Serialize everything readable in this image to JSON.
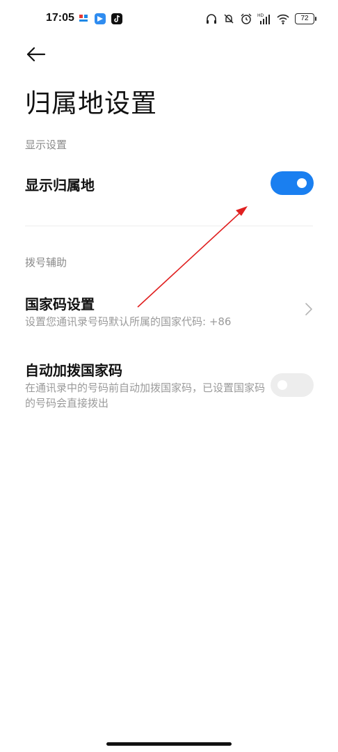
{
  "status_bar": {
    "time": "17:05",
    "battery": "72",
    "icons": [
      "headphones-icon",
      "mute-icon",
      "alarm-icon",
      "hd-signal-icon",
      "wifi-icon",
      "battery-icon"
    ],
    "apps": [
      "news-app-icon",
      "message-app-icon",
      "tiktok-app-icon"
    ]
  },
  "header": {
    "title": "归属地设置"
  },
  "sections": {
    "display": {
      "label": "显示设置",
      "show_location_label": "显示归属地",
      "show_location_enabled": true
    },
    "dial_assist": {
      "label": "拨号辅助",
      "country_code_title": "国家码设置",
      "country_code_desc": "设置您通讯录号码默认所属的国家代码: +86",
      "auto_add_title": "自动加拨国家码",
      "auto_add_desc": "在通讯录中的号码前自动加拨国家码，已设置国家码的号码会直接拨出",
      "auto_add_enabled": false
    }
  },
  "colors": {
    "accent": "#1a7ff0",
    "toggle_off": "#ededed",
    "annotation_arrow": "#e02020"
  }
}
